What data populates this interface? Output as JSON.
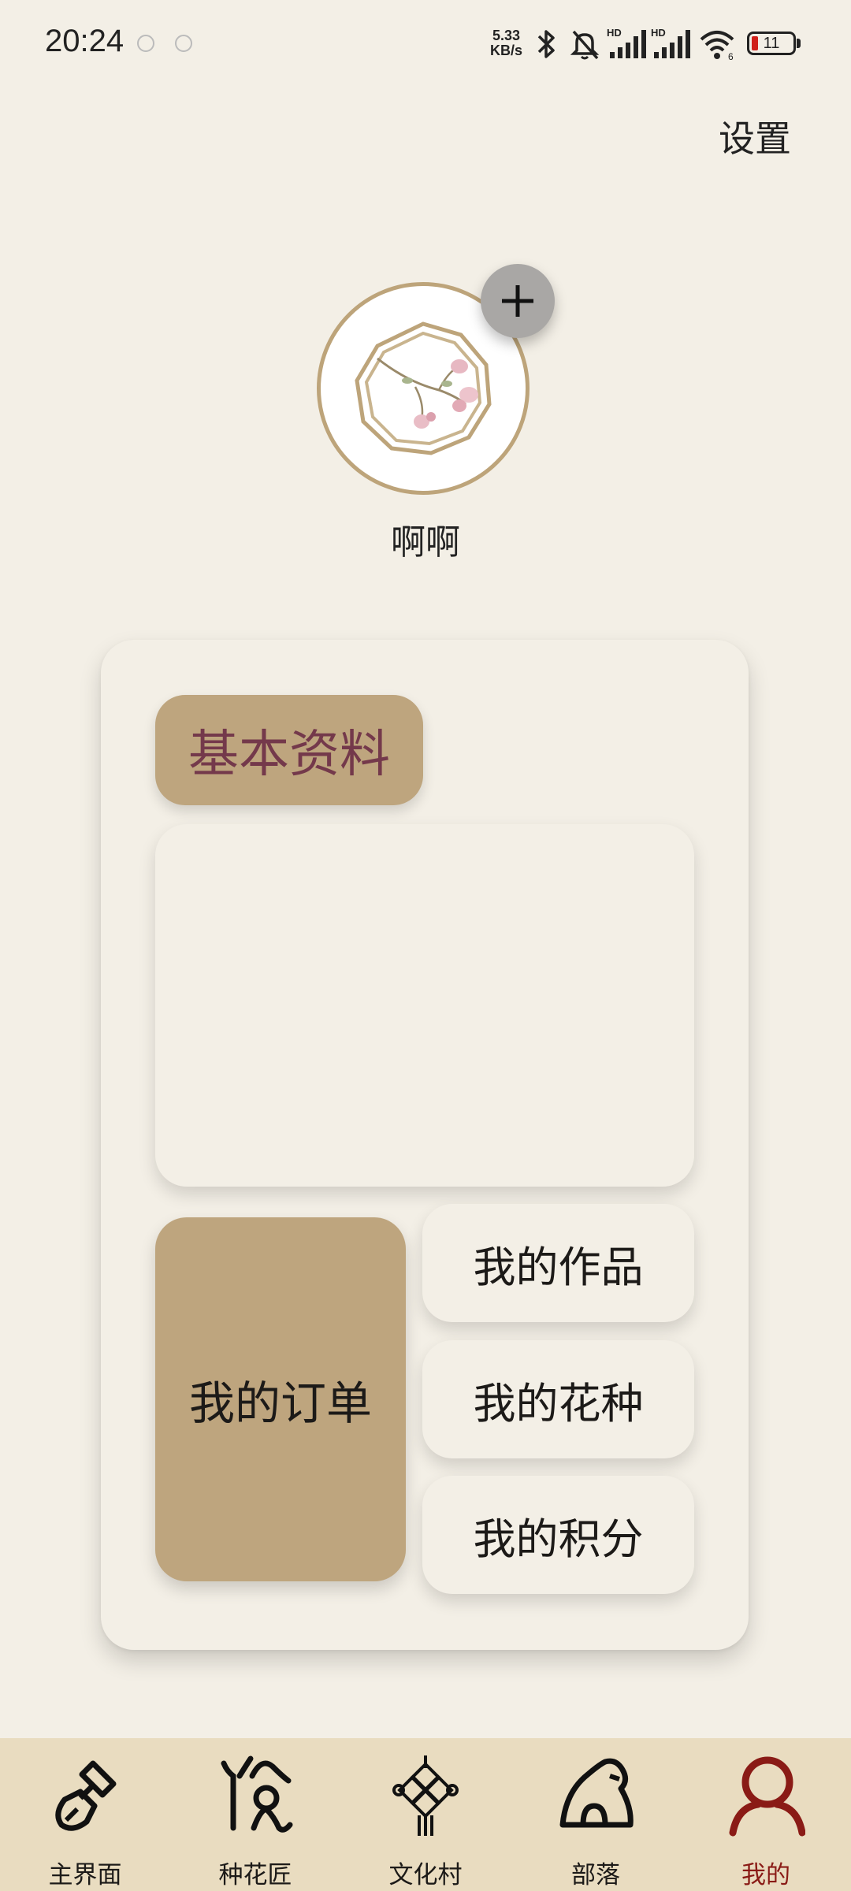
{
  "status_bar": {
    "time": "20:24",
    "net_speed_value": "5.33",
    "net_speed_unit": "KB/s",
    "battery": "11",
    "battery_color": "#d0201a"
  },
  "header": {
    "settings_label": "设置"
  },
  "profile": {
    "username": "啊啊",
    "avatar_icon": "flower-branch-emblem-icon",
    "add_icon": "plus-icon"
  },
  "card": {
    "section_tag": "基本资料",
    "orders_label": "我的订单",
    "buttons": [
      {
        "label": "我的作品"
      },
      {
        "label": "我的花种"
      },
      {
        "label": "我的积分"
      }
    ]
  },
  "tabbar": {
    "items": [
      {
        "label": "主界面",
        "icon": "shovel-icon"
      },
      {
        "label": "种花匠",
        "icon": "gardener-icon"
      },
      {
        "label": "文化村",
        "icon": "chinese-knot-icon"
      },
      {
        "label": "部落",
        "icon": "hut-icon"
      },
      {
        "label": "我的",
        "icon": "person-icon"
      }
    ],
    "active_color": "#8a1b16"
  },
  "colors": {
    "background": "#f3efe6",
    "accent_tan": "#bea57e",
    "tag_text": "#74394b",
    "tabbar_bg": "#e9dcc0"
  }
}
